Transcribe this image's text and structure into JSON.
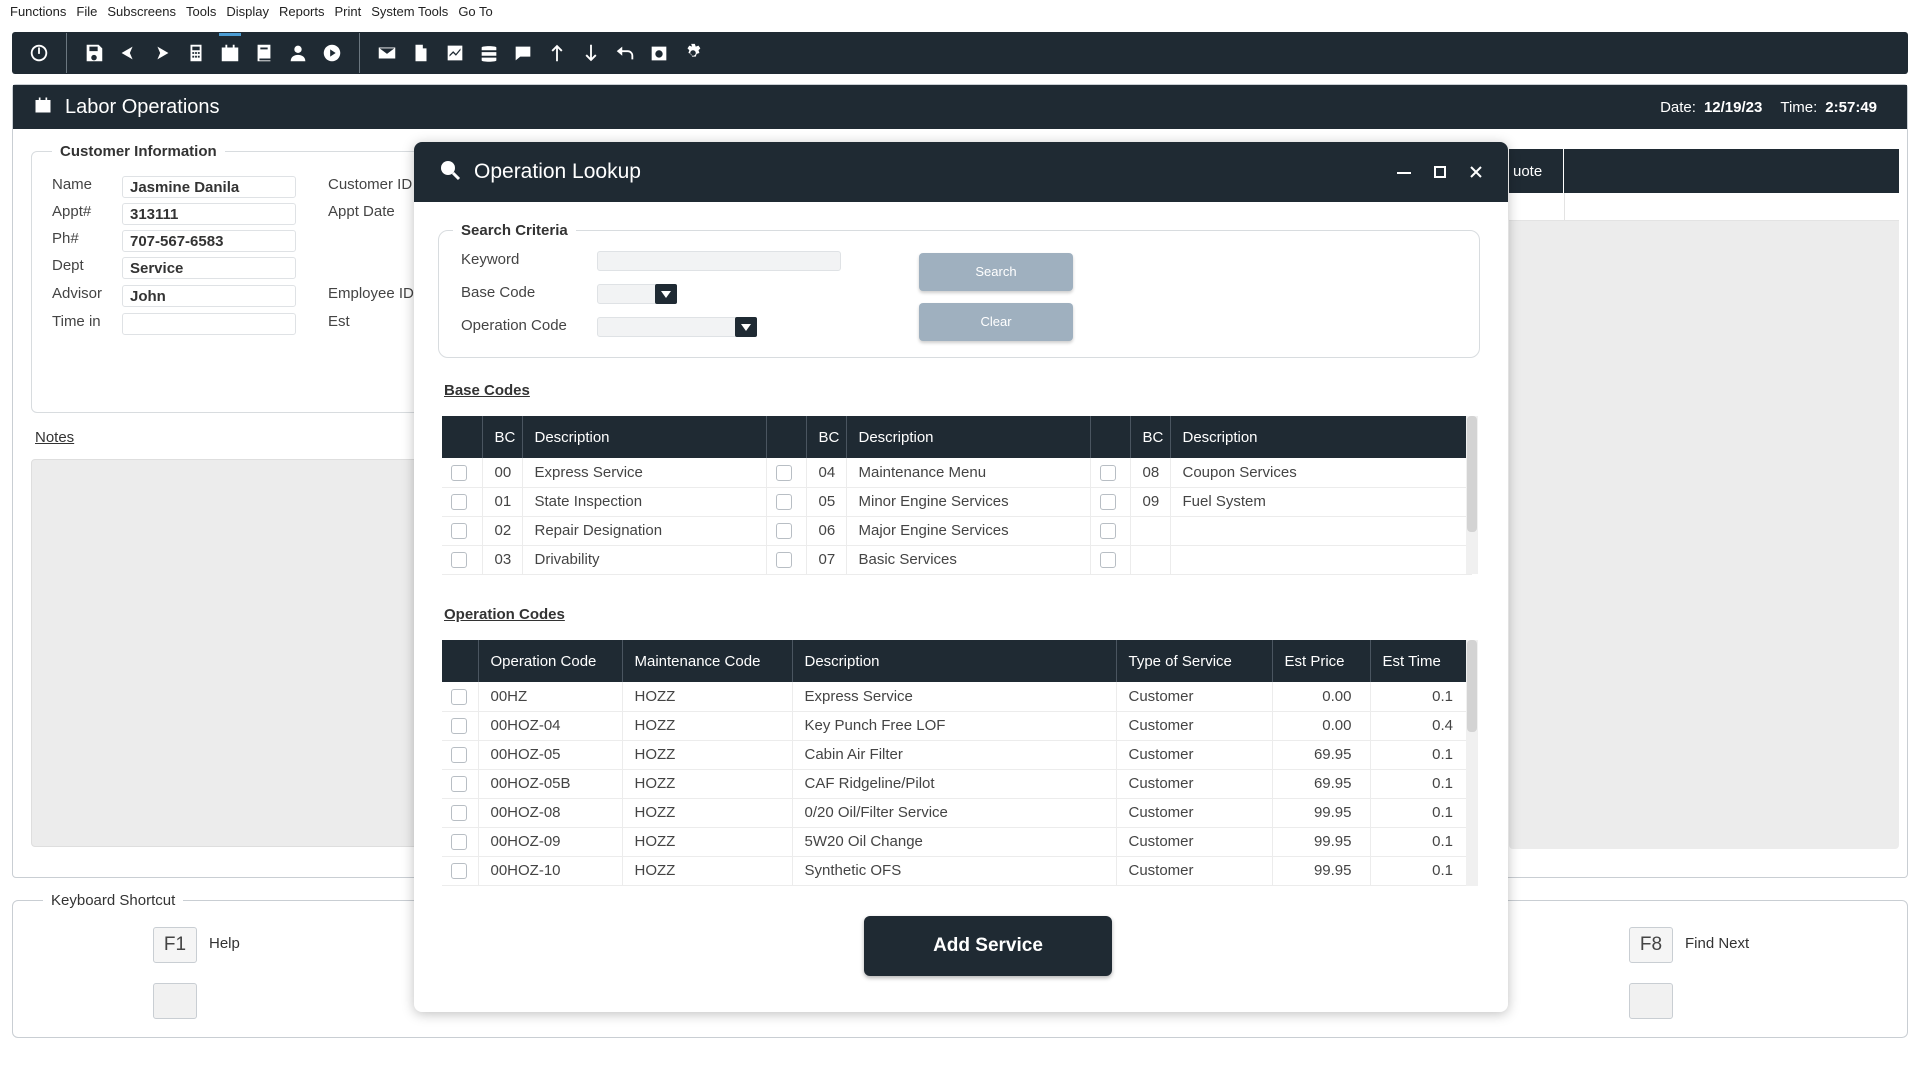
{
  "menu": [
    "Functions",
    "File",
    "Subscreens",
    "Tools",
    "Display",
    "Reports",
    "Print",
    "System Tools",
    "Go To"
  ],
  "toolbar": {
    "icons": [
      "power-icon",
      "save-icon",
      "back-icon",
      "forward-icon",
      "calculator-icon",
      "calendar-icon",
      "book-icon",
      "user-icon",
      "play-icon",
      "mail-icon",
      "document-icon",
      "chart-icon",
      "database-icon",
      "chat-icon",
      "arrow-up-icon",
      "arrow-down-icon",
      "undo-icon",
      "camera-icon",
      "gear-icon"
    ]
  },
  "window": {
    "title": "Labor Operations",
    "date_label": "Date:",
    "date_value": "12/19/23",
    "time_label": "Time:",
    "time_value": "2:57:49"
  },
  "customer": {
    "legend": "Customer Information",
    "name_label": "Name",
    "name_value": "Jasmine Danila",
    "appt_label": "Appt#",
    "appt_value": "313111",
    "ph_label": "Ph#",
    "ph_value": "707-567-6583",
    "dept_label": "Dept",
    "dept_value": "Service",
    "advisor_label": "Advisor",
    "advisor_value": "John",
    "timein_label": "Time in",
    "timein_value": "",
    "customer_id_label": "Customer ID",
    "appt_date_label": "Appt Date",
    "employee_id_label": "Employee ID",
    "est_label": "Est"
  },
  "notes_label": "Notes",
  "right_panel": {
    "quote_col": "uote"
  },
  "keyboard": {
    "legend": "Keyboard Shortcut",
    "f1_key": "F1",
    "f1_label": "Help",
    "f8_key": "F8",
    "f8_label": "Find Next"
  },
  "modal": {
    "title": "Operation Lookup",
    "search_legend": "Search Criteria",
    "keyword_label": "Keyword",
    "keyword_value": "",
    "base_code_label": "Base Code",
    "operation_code_label": "Operation Code",
    "search_button": "Search",
    "clear_button": "Clear",
    "base_codes_title": "Base Codes",
    "base_codes_headers": {
      "bc": "BC",
      "desc": "Description"
    },
    "base_codes_rows": [
      [
        [
          "00",
          "Express Service"
        ],
        [
          "04",
          "Maintenance Menu"
        ],
        [
          "08",
          "Coupon Services"
        ]
      ],
      [
        [
          "01",
          "State Inspection"
        ],
        [
          "05",
          "Minor Engine Services"
        ],
        [
          "09",
          "Fuel System"
        ]
      ],
      [
        [
          "02",
          "Repair Designation"
        ],
        [
          "06",
          "Major Engine Services"
        ],
        [
          "",
          ""
        ]
      ],
      [
        [
          "03",
          "Drivability"
        ],
        [
          "07",
          "Basic Services"
        ],
        [
          "",
          ""
        ]
      ]
    ],
    "operation_codes_title": "Operation Codes",
    "operation_headers": [
      "Operation Code",
      "Maintenance Code",
      "Description",
      "Type of Service",
      "Est Price",
      "Est Time"
    ],
    "operation_rows": [
      [
        "00HZ",
        "HOZZ",
        "Express Service",
        "Customer",
        "0.00",
        "0.1"
      ],
      [
        "00HOZ-04",
        "HOZZ",
        "Key Punch Free LOF",
        "Customer",
        "0.00",
        "0.4"
      ],
      [
        "00HOZ-05",
        "HOZZ",
        "Cabin Air Filter",
        "Customer",
        "69.95",
        "0.1"
      ],
      [
        "00HOZ-05B",
        "HOZZ",
        "CAF Ridgeline/Pilot",
        "Customer",
        "69.95",
        "0.1"
      ],
      [
        "00HOZ-08",
        "HOZZ",
        "0/20 Oil/Filter Service",
        "Customer",
        "99.95",
        "0.1"
      ],
      [
        "00HOZ-09",
        "HOZZ",
        "5W20 Oil Change",
        "Customer",
        "99.95",
        "0.1"
      ],
      [
        "00HOZ-10",
        "HOZZ",
        "Synthetic OFS",
        "Customer",
        "99.95",
        "0.1"
      ]
    ],
    "add_button": "Add Service"
  },
  "colors": {
    "dark": "#1f2a33",
    "button_muted": "#9fb0bf",
    "accent": "#4b9cd3"
  }
}
